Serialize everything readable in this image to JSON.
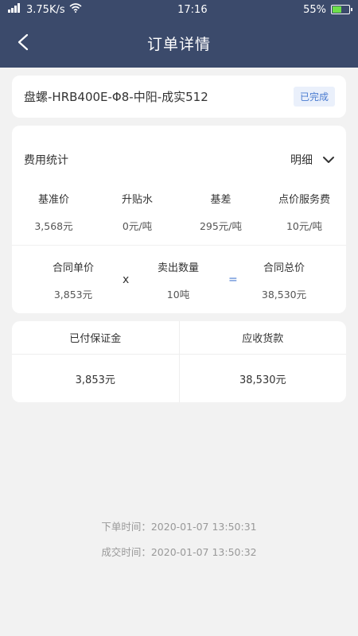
{
  "status_bar": {
    "carrier_icon": "signal-icon",
    "speed": "3.75K/s",
    "time": "17:16",
    "battery": "55%",
    "battery_level": 0.55,
    "battery_color": "#6ee04a"
  },
  "nav": {
    "title": "订单详情",
    "back_icon": "chevron-left-icon",
    "bg_color": "#3b4a6b"
  },
  "order": {
    "product": "盘螺-HRB400E-Φ8-中阳-成实512",
    "status": "已完成"
  },
  "fees": {
    "title": "费用统计",
    "detail_label": "明细",
    "items": [
      {
        "label": "基准价",
        "value": "3,568元"
      },
      {
        "label": "升贴水",
        "value": "0元/吨"
      },
      {
        "label": "基差",
        "value": "295元/吨"
      },
      {
        "label": "点价服务费",
        "value": "10元/吨"
      }
    ],
    "formula": {
      "unit_price_label": "合同单价",
      "unit_price_value": "3,853元",
      "times_symbol": "x",
      "quantity_label": "卖出数量",
      "quantity_value": "10吨",
      "equals_symbol": "=",
      "total_label": "合同总价",
      "total_value": "38,530元"
    }
  },
  "payment": {
    "deposit_label": "已付保证金",
    "deposit_value": "3,853元",
    "receivable_label": "应收货款",
    "receivable_value": "38,530元"
  },
  "times": {
    "order_time": "下单时间：2020-01-07 13:50:31",
    "deal_time": "成交时间：2020-01-07 13:50:32"
  }
}
